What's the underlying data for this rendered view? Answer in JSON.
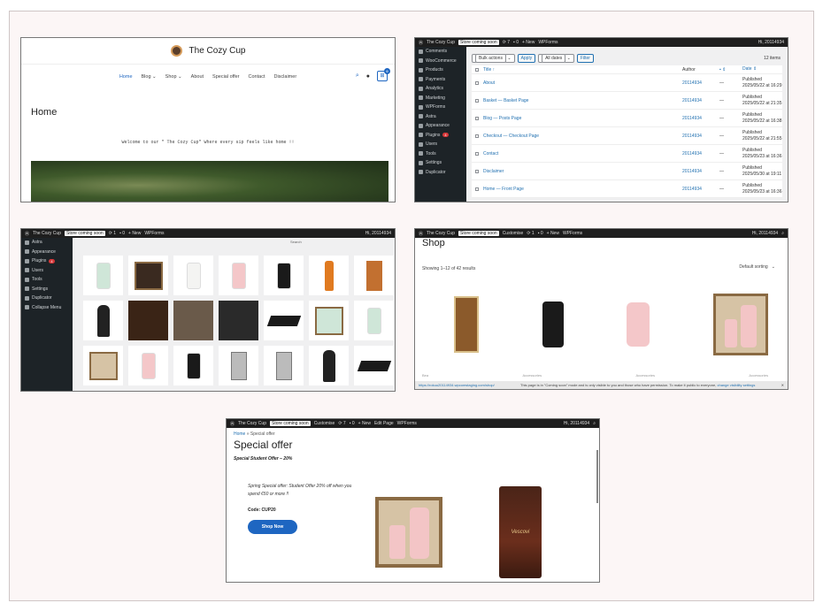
{
  "shot1": {
    "brand": "The Cozy Cup",
    "nav": [
      "Home",
      "Blog",
      "Shop",
      "About",
      "Special offer",
      "Contact",
      "Disclaimer"
    ],
    "cart_count": "0",
    "heading": "Home",
    "welcome": "Welcome to our \" The Cozy Cup\" Where every sip feels like home !!"
  },
  "shot2": {
    "bar": {
      "site": "The Cozy Cup",
      "tag": "Store coming soon",
      "comments": "0",
      "new": "+ New",
      "wpforms": "WPForms",
      "howdy": "Hi, 20114934"
    },
    "sidebar": [
      {
        "label": "Comments",
        "icon": "comments-icon"
      },
      {
        "label": "WooCommerce",
        "icon": "woocommerce-icon"
      },
      {
        "label": "Products",
        "icon": "products-icon"
      },
      {
        "label": "Payments",
        "icon": "payments-icon"
      },
      {
        "label": "Analytics",
        "icon": "analytics-icon"
      },
      {
        "label": "Marketing",
        "icon": "marketing-icon"
      },
      {
        "label": "WPForms",
        "icon": "wpforms-icon"
      },
      {
        "label": "Astra",
        "icon": "astra-icon"
      },
      {
        "label": "Appearance",
        "icon": "appearance-icon"
      },
      {
        "label": "Plugins",
        "icon": "plugins-icon",
        "badge": "4"
      },
      {
        "label": "Users",
        "icon": "users-icon"
      },
      {
        "label": "Tools",
        "icon": "tools-icon"
      },
      {
        "label": "Settings",
        "icon": "settings-icon"
      },
      {
        "label": "Duplicator",
        "icon": "duplicator-icon"
      }
    ],
    "bulk": "Bulk actions",
    "apply": "Apply",
    "dates": "All dates",
    "filter": "Filter",
    "count": "12 items",
    "headers": {
      "title": "Title",
      "author": "Author",
      "date": "Date"
    },
    "rows": [
      {
        "title": "About",
        "author": "20114934",
        "comments": "—",
        "status": "Published",
        "date": "2025/05/22 at 16:29"
      },
      {
        "title": "Basket — Basket Page",
        "author": "20114934",
        "comments": "—",
        "status": "Published",
        "date": "2025/05/22 at 21:35"
      },
      {
        "title": "Blog — Posts Page",
        "author": "20114934",
        "comments": "—",
        "status": "Published",
        "date": "2025/05/22 at 16:38"
      },
      {
        "title": "Checkout — Checkout Page",
        "author": "20114934",
        "comments": "—",
        "status": "Published",
        "date": "2025/05/22 at 21:55"
      },
      {
        "title": "Contact",
        "author": "20114934",
        "comments": "—",
        "status": "Published",
        "date": "2025/05/23 at 16:36"
      },
      {
        "title": "Disclaimer",
        "author": "20114934",
        "comments": "—",
        "status": "Published",
        "date": "2025/05/30 at 19:11"
      },
      {
        "title": "Home — Front Page",
        "author": "20114934",
        "comments": "—",
        "status": "Published",
        "date": "2025/05/23 at 16:36"
      }
    ]
  },
  "shot3": {
    "bar": {
      "site": "The Cozy Cup",
      "tag": "Store coming soon",
      "updates": "1",
      "comments": "0",
      "new": "+ New",
      "wpforms": "WPForms",
      "howdy": "Hi, 20114934"
    },
    "sidebar": [
      {
        "label": "Astra",
        "icon": "astra-icon"
      },
      {
        "label": "Appearance",
        "icon": "appearance-icon"
      },
      {
        "label": "Plugins",
        "icon": "plugins-icon",
        "badge": "4"
      },
      {
        "label": "Users",
        "icon": "users-icon"
      },
      {
        "label": "Tools",
        "icon": "tools-icon"
      },
      {
        "label": "Settings",
        "icon": "settings-icon"
      },
      {
        "label": "Duplicator",
        "icon": "duplicator-icon"
      },
      {
        "label": "Collapse Menu",
        "icon": "collapse-icon"
      }
    ],
    "search_label": "Search"
  },
  "shot4": {
    "bar": {
      "site": "The Cozy Cup",
      "tag": "Store coming soon",
      "customise": "Customise",
      "updates": "1",
      "comments": "0",
      "new": "+ New",
      "wpforms": "WPForms",
      "howdy": "Hi, 20114934"
    },
    "heading": "Shop",
    "showing": "Showing 1–12 of 42 results",
    "sorting": "Default sorting",
    "labels": [
      "Bea",
      "Accessories",
      "Accessories",
      "Accessories"
    ],
    "notice": "This page is in \"Coming soon\" mode and is only visible to you and those who have permission. To make it public to everyone,",
    "notice_link": "change visibility settings",
    "url": "https://rokuu20114934.wpcomstaging.com/shop/"
  },
  "shot5": {
    "bar": {
      "site": "The Cozy Cup",
      "tag": "Store coming soon",
      "customise": "Customise",
      "updates": "7",
      "comments": "0",
      "new": "+ New",
      "edit": "Edit Page",
      "wpforms": "WPForms",
      "howdy": "Hi, 20114934"
    },
    "crumb_home": "Home",
    "crumb_sep": " » ",
    "crumb_current": "Special offer",
    "heading": "Special offer",
    "subheading": "Special Student Offer – 20%",
    "desc": "Spring Special offer: Student Offer 20% off when you spend  €50 or more !!",
    "code": "Code: CUP20",
    "button": "Shop Now",
    "bag_brand": "Vescovi"
  },
  "colors": {
    "accent": "#1e66c1",
    "wp_admin": "#1d2327",
    "link": "#2271b1"
  }
}
